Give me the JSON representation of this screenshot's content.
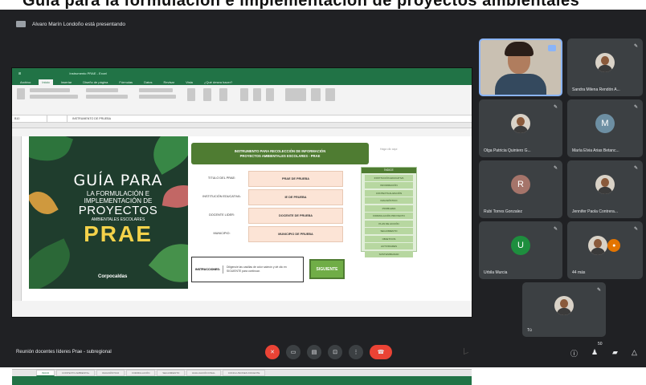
{
  "page_title": "Guía para la formulación e implementación de proyectos ambientales escolares",
  "presenter": {
    "text": "Alvaro Marín Londoño está presentando"
  },
  "excel": {
    "title": "Instrumento PRAE - Excel",
    "tabs": [
      "Archivo",
      "Inicio",
      "Insertar",
      "Diseño de página",
      "Fórmulas",
      "Datos",
      "Revisar",
      "Vista",
      "¿Qué desea hacer?"
    ],
    "active_tab": "Inicio",
    "name_box": "B10",
    "formula": "INSTRUMENTO DE PRUEBA",
    "banner_line1": "INSTRUMENTO PARA RECOLECCIÓN DE INFORMACIÓN",
    "banner_line2": "PROYECTOS AMBIENTALES ESCOLARES - PRAE",
    "gray_note": "Haga clic aquí",
    "fields": [
      {
        "label": "TITULO DEL PRAE:",
        "value": "PRAE DE PRUEBA"
      },
      {
        "label": "INSTITUCIÓN EDUCATIVA:",
        "value": "IE DE PRUEBA"
      },
      {
        "label": "DOCENTE LIDER:",
        "value": "DOCENTE DE PRUEBA"
      },
      {
        "label": "MUNICIPIO:",
        "value": "MUNICIPIO DE PRUEBA"
      }
    ],
    "index_title": "ÍNDICE",
    "index_items": [
      "INSTITUCIÓN EDUCATIVA",
      "INFORMACIÓN",
      "CONTEXTUALIZACIÓN",
      "DIAGNÓSTICO",
      "PROBLEMA",
      "FORMULACIÓN PROYECTO",
      "PLAN DE ACCIÓN",
      "SEGUIMIENTO",
      "OBJETIVOS",
      "ACTIVIDADES",
      "SOSTENIBILIDAD",
      "GESTIÓN"
    ],
    "instructions_label": "INSTRUCCIONES:",
    "instructions_text": "Diligencie las casillas de color salmón y dé clic en SIGUIENTE para continuar.",
    "next_button": "SIGUIENTE",
    "sheet_tabs": [
      "INICIO",
      "CONTEXTO AMBIENTAL",
      "DIAGNÓSTICO",
      "FORMULACIÓN",
      "SEGUIMIENTO",
      "EVALUACIÓN FINAL",
      "CONCLUSIONES DOCENTE"
    ],
    "active_sheet": "INICIO"
  },
  "cover": {
    "line1": "GUÍA PARA",
    "line2": "LA FORMULACIÓN E",
    "line3": "IMPLEMENTACIÓN DE",
    "line4": "PROYECTOS",
    "line5": "AMBIENTALES ESCOLARES",
    "line6": "PRAE",
    "logo": "Corpocaldas"
  },
  "participants": [
    {
      "name": "Sandra Milena Rendón A...",
      "kind": "photo"
    },
    {
      "name": "Olga Patricia Quintero G...",
      "kind": "photo"
    },
    {
      "name": "María Elvia Arias Betanc...",
      "kind": "initial",
      "initial": "M",
      "color": "#6d8fa3"
    },
    {
      "name": "Rubi Torres Gonzalez",
      "kind": "initial",
      "initial": "R",
      "color": "#a5746a"
    },
    {
      "name": "Jennifer Paola Contrera...",
      "kind": "photo"
    },
    {
      "name": "Urbila Murcia",
      "kind": "initial",
      "initial": "U",
      "color": "#1e8e3e"
    },
    {
      "name": "44 más",
      "kind": "more"
    },
    {
      "name": "Tú",
      "kind": "photo"
    }
  ],
  "meeting_name": "Reunión docentes líderes Prae - subregional",
  "controls": [
    "mic-off",
    "camera",
    "captions",
    "present",
    "more",
    "hang-up"
  ],
  "right_controls": [
    "info",
    "people",
    "chat",
    "activities"
  ],
  "people_count": "50"
}
